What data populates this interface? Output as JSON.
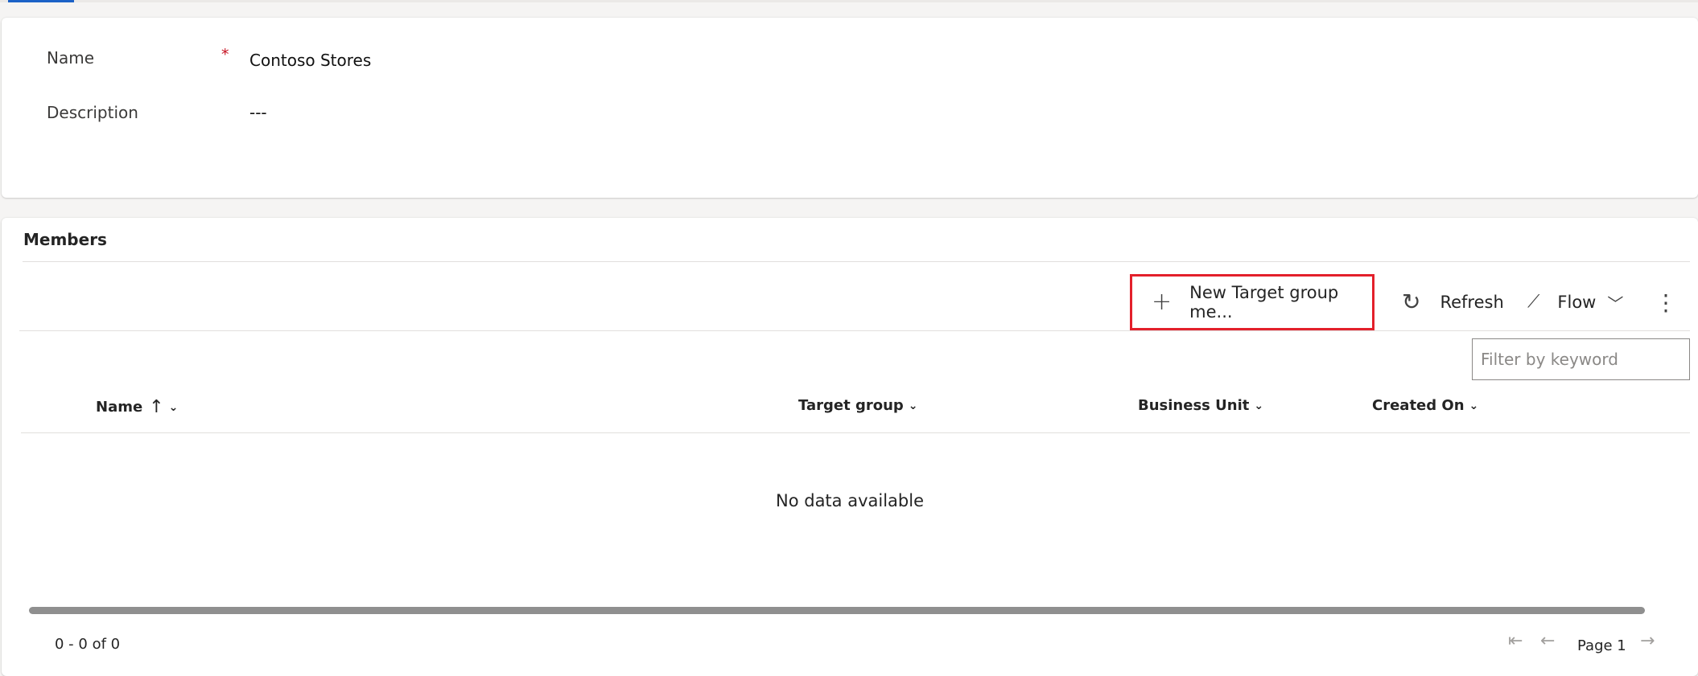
{
  "form": {
    "name_label": "Name",
    "name_required_marker": "*",
    "name_value": "Contoso Stores",
    "description_label": "Description",
    "description_value": "---"
  },
  "members": {
    "title": "Members",
    "toolbar": {
      "new_label": "New Target group me...",
      "new_icon": "plus-icon",
      "refresh_label": "Refresh",
      "refresh_icon": "refresh-icon",
      "flow_label": "Flow",
      "flow_icon": "flow-icon",
      "more_icon": "more-vertical-icon"
    },
    "filter_placeholder": "Filter by keyword",
    "columns": [
      {
        "label": "Name",
        "sorted": "ascending"
      },
      {
        "label": "Target group"
      },
      {
        "label": "Business Unit"
      },
      {
        "label": "Created On"
      }
    ],
    "empty_message": "No data available",
    "pager": {
      "count_text": "0 - 0 of 0",
      "page_label": "Page 1"
    }
  },
  "colors": {
    "highlight_border": "#e3202b",
    "tab_indicator": "#1c62c7",
    "required": "#c50f1f"
  }
}
